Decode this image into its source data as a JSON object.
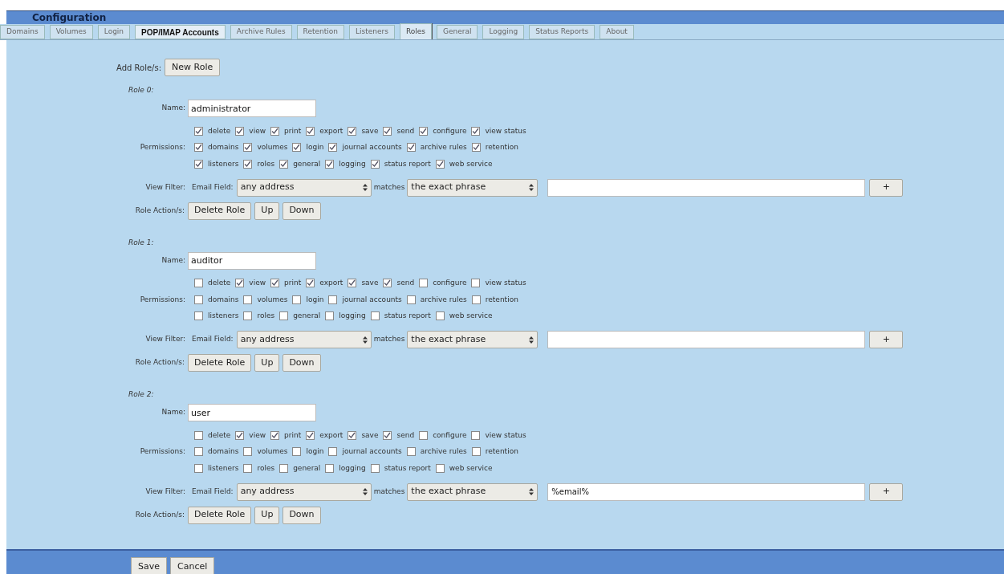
{
  "header": {
    "title": "Configuration"
  },
  "tabs": [
    {
      "label": "Domains",
      "selected": false,
      "hovered": false
    },
    {
      "label": "Volumes",
      "selected": false,
      "hovered": false
    },
    {
      "label": "Login",
      "selected": false,
      "hovered": false
    },
    {
      "label": "POP/IMAP  Accounts",
      "selected": false,
      "hovered": true
    },
    {
      "label": "Archive Rules",
      "selected": false,
      "hovered": false
    },
    {
      "label": "Retention",
      "selected": false,
      "hovered": false
    },
    {
      "label": "Listeners",
      "selected": false,
      "hovered": false
    },
    {
      "label": "Roles",
      "selected": true,
      "hovered": false
    },
    {
      "label": "General",
      "selected": false,
      "hovered": false
    },
    {
      "label": "Logging",
      "selected": false,
      "hovered": false
    },
    {
      "label": "Status Reports",
      "selected": false,
      "hovered": false
    },
    {
      "label": "About",
      "selected": false,
      "hovered": false
    }
  ],
  "add_role": {
    "label": "Add Role/s:",
    "button": "New Role"
  },
  "roles": [
    {
      "heading": "Role 0:",
      "name_label": "Name:",
      "name": "administrator",
      "permissions_label": "Permissions:",
      "permission_rows": [
        [
          {
            "label": "delete",
            "checked": true
          },
          {
            "label": "view",
            "checked": true
          },
          {
            "label": "print",
            "checked": true
          },
          {
            "label": "export",
            "checked": true
          },
          {
            "label": "save",
            "checked": true
          },
          {
            "label": "send",
            "checked": true
          },
          {
            "label": "configure",
            "checked": true
          },
          {
            "label": "view status",
            "checked": true
          }
        ],
        [
          {
            "label": "domains",
            "checked": true
          },
          {
            "label": "volumes",
            "checked": true
          },
          {
            "label": "login",
            "checked": true
          },
          {
            "label": "journal accounts",
            "checked": true
          },
          {
            "label": "archive rules",
            "checked": true
          },
          {
            "label": "retention",
            "checked": true
          }
        ],
        [
          {
            "label": "listeners",
            "checked": true
          },
          {
            "label": "roles",
            "checked": true
          },
          {
            "label": "general",
            "checked": true
          },
          {
            "label": "logging",
            "checked": true
          },
          {
            "label": "status report",
            "checked": true
          },
          {
            "label": "web service",
            "checked": true
          }
        ]
      ],
      "view_filter": {
        "label": "View Filter:",
        "field_label": "Email Field:",
        "field": "any address",
        "matches_label": "matches",
        "match": "the exact phrase",
        "add_button": "+"
      },
      "actions_label": "Role Action/s:",
      "actions": [
        "Delete Role",
        "Up",
        "Down"
      ]
    },
    {
      "heading": "Role 1:",
      "name_label": "Name:",
      "name": "auditor",
      "permissions_label": "Permissions:",
      "permission_rows": [
        [
          {
            "label": "delete",
            "checked": false
          },
          {
            "label": "view",
            "checked": true
          },
          {
            "label": "print",
            "checked": true
          },
          {
            "label": "export",
            "checked": true
          },
          {
            "label": "save",
            "checked": true
          },
          {
            "label": "send",
            "checked": true
          },
          {
            "label": "configure",
            "checked": false
          },
          {
            "label": "view status",
            "checked": false
          }
        ],
        [
          {
            "label": "domains",
            "checked": false
          },
          {
            "label": "volumes",
            "checked": false
          },
          {
            "label": "login",
            "checked": false
          },
          {
            "label": "journal accounts",
            "checked": false
          },
          {
            "label": "archive rules",
            "checked": false
          },
          {
            "label": "retention",
            "checked": false
          }
        ],
        [
          {
            "label": "listeners",
            "checked": false
          },
          {
            "label": "roles",
            "checked": false
          },
          {
            "label": "general",
            "checked": false
          },
          {
            "label": "logging",
            "checked": false
          },
          {
            "label": "status report",
            "checked": false
          },
          {
            "label": "web service",
            "checked": false
          }
        ]
      ],
      "view_filter": {
        "label": "View Filter:",
        "field_label": "Email Field:",
        "field": "any address",
        "matches_label": "matches",
        "match": "the exact phrase",
        "add_button": "+"
      },
      "actions_label": "Role Action/s:",
      "actions": [
        "Delete Role",
        "Up",
        "Down"
      ]
    },
    {
      "heading": "Role 2:",
      "name_label": "Name:",
      "name": "user",
      "permissions_label": "Permissions:",
      "permission_rows": [
        [
          {
            "label": "delete",
            "checked": false
          },
          {
            "label": "view",
            "checked": true
          },
          {
            "label": "print",
            "checked": true
          },
          {
            "label": "export",
            "checked": true
          },
          {
            "label": "save",
            "checked": true
          },
          {
            "label": "send",
            "checked": true
          },
          {
            "label": "configure",
            "checked": false
          },
          {
            "label": "view status",
            "checked": false
          }
        ],
        [
          {
            "label": "domains",
            "checked": false
          },
          {
            "label": "volumes",
            "checked": false
          },
          {
            "label": "login",
            "checked": false
          },
          {
            "label": "journal accounts",
            "checked": false
          },
          {
            "label": "archive rules",
            "checked": false
          },
          {
            "label": "retention",
            "checked": false
          }
        ],
        [
          {
            "label": "listeners",
            "checked": false
          },
          {
            "label": "roles",
            "checked": false
          },
          {
            "label": "general",
            "checked": false
          },
          {
            "label": "logging",
            "checked": false
          },
          {
            "label": "status report",
            "checked": false
          },
          {
            "label": "web service",
            "checked": false
          }
        ]
      ],
      "view_filter": {
        "label": "View Filter:",
        "field_label": "Email Field:",
        "field": "any address",
        "matches_label": "matches",
        "match": "the exact phrase",
        "value": "%email%",
        "add_button": "+"
      },
      "actions_label": "Role Action/s:",
      "actions": [
        "Delete Role",
        "Up",
        "Down"
      ]
    }
  ],
  "footer": {
    "buttons": [
      "Save",
      "Cancel"
    ]
  }
}
